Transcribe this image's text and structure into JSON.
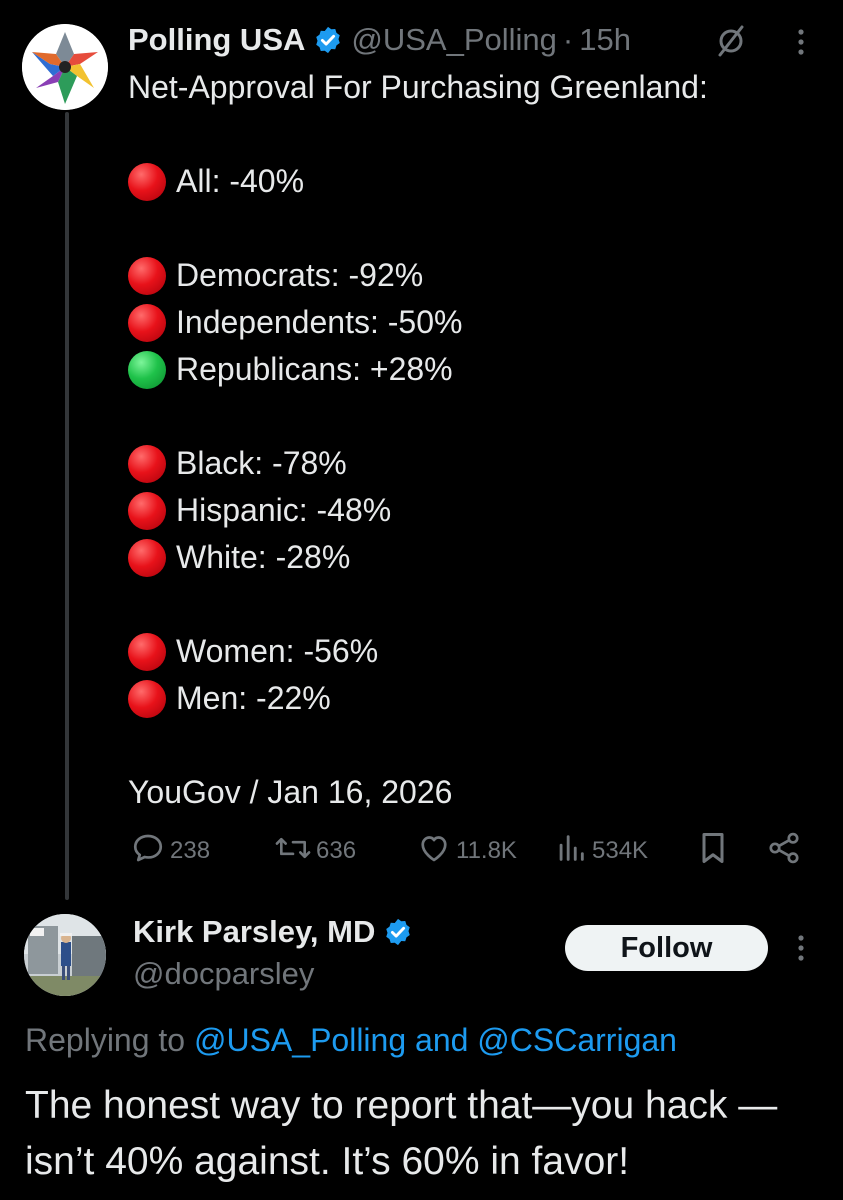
{
  "tweet": {
    "author_name": "Polling USA",
    "author_handle": "@USA_Polling",
    "separator": "·",
    "time": "15h",
    "title_line": "Net-Approval For Purchasing Greenland:",
    "groups": [
      [
        {
          "label": "All: -40%",
          "color": "red"
        }
      ],
      [
        {
          "label": "Democrats: -92%",
          "color": "red"
        },
        {
          "label": "Independents: -50%",
          "color": "red"
        },
        {
          "label": "Republicans: +28%",
          "color": "green"
        }
      ],
      [
        {
          "label": "Black: -78%",
          "color": "red"
        },
        {
          "label": "Hispanic: -48%",
          "color": "red"
        },
        {
          "label": "White: -28%",
          "color": "red"
        }
      ],
      [
        {
          "label": "Women: -56%",
          "color": "red"
        },
        {
          "label": "Men: -22%",
          "color": "red"
        }
      ]
    ],
    "source": "YouGov / Jan 16, 2026",
    "stats": {
      "replies": "238",
      "reposts": "636",
      "likes": "11.8K",
      "views": "534K"
    }
  },
  "reply": {
    "author_name": "Kirk Parsley, MD",
    "author_handle": "@docparsley",
    "follow_label": "Follow",
    "replying_prefix": "Replying to",
    "replying_mentions": "@USA_Polling and @CSCarrigan",
    "text": "The honest way to report that—you hack —isn’t 40% against. It’s 60% in favor!"
  },
  "colors": {
    "background": "#000000",
    "text": "#e7e9ea",
    "muted": "#71767b",
    "accent": "#1d9bf0",
    "indicator_red": "#e8121a",
    "indicator_green": "#1fc24a"
  },
  "icons": [
    "verified-badge-icon",
    "grok-icon",
    "more-icon",
    "reply-icon",
    "repost-icon",
    "like-icon",
    "views-icon",
    "bookmark-icon",
    "share-icon"
  ]
}
